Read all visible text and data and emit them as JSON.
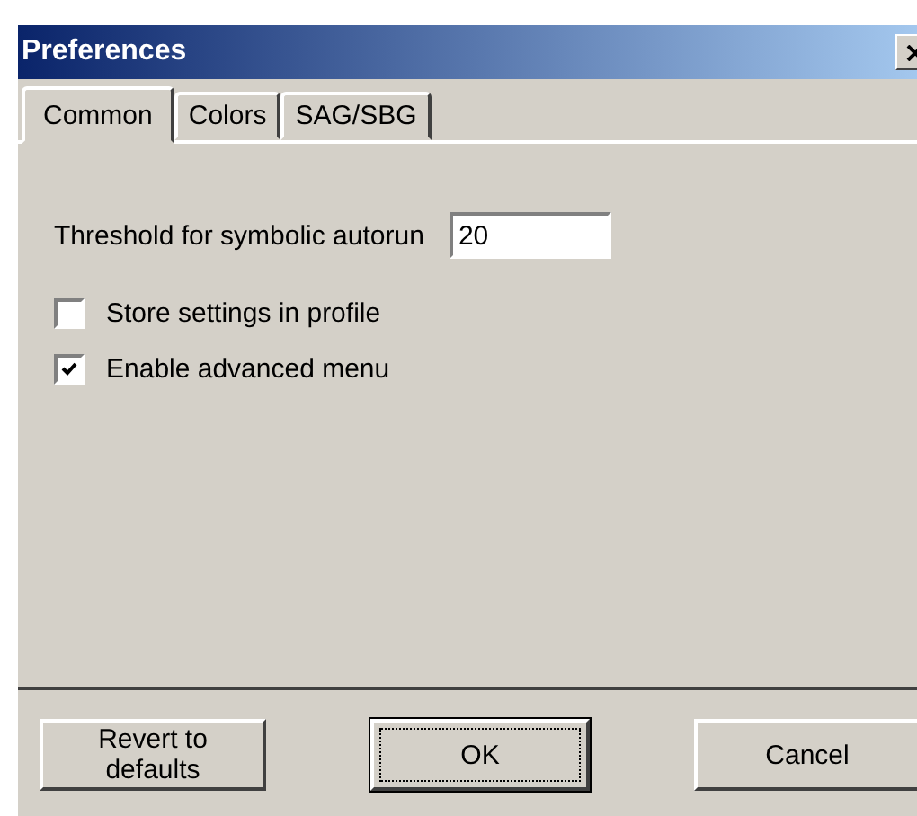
{
  "window": {
    "title": "Preferences"
  },
  "tabs": [
    {
      "label": "Common",
      "selected": true
    },
    {
      "label": "Colors",
      "selected": false
    },
    {
      "label": "SAG/SBG",
      "selected": false
    }
  ],
  "threshold": {
    "label": "Threshold for symbolic autorun",
    "value": "20"
  },
  "options": [
    {
      "label": "Store settings in profile",
      "checked": false
    },
    {
      "label": "Enable advanced menu",
      "checked": true
    }
  ],
  "buttons": [
    {
      "label": "Revert to defaults",
      "default": false
    },
    {
      "label": "OK",
      "default": true
    },
    {
      "label": "Cancel",
      "default": false
    }
  ]
}
